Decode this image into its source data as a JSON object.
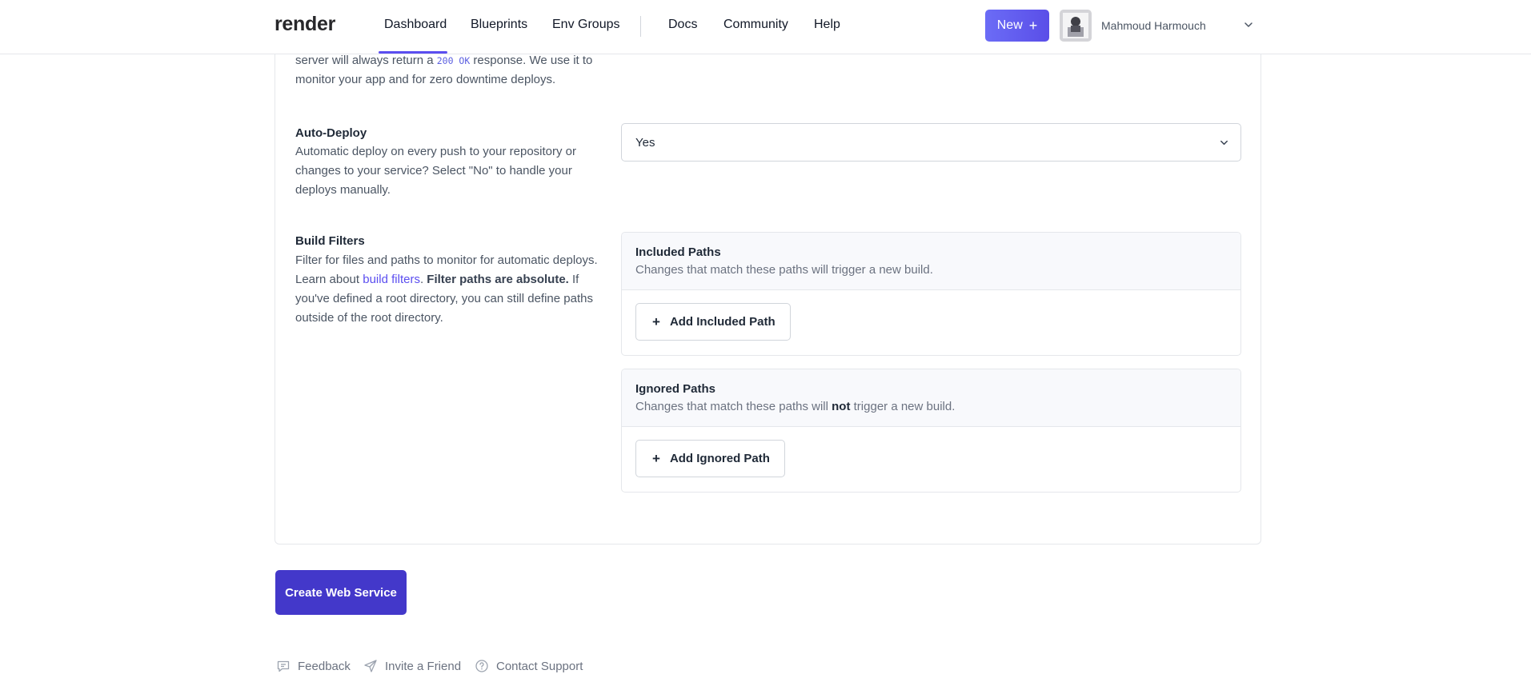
{
  "nav": {
    "logo": "render",
    "links": [
      "Dashboard",
      "Blueprints",
      "Env Groups",
      "Docs",
      "Community",
      "Help"
    ],
    "new_button": "New",
    "user_name": "Mahmoud Harmouch"
  },
  "health": {
    "desc_before": "server will always return a ",
    "code": "200 OK",
    "desc_after": " response. We use it to monitor your app and for zero downtime deploys."
  },
  "auto_deploy": {
    "label": "Auto-Deploy",
    "description": "Automatic deploy on every push to your repository or changes to your service? Select \"No\" to handle your deploys manually.",
    "selected": "Yes"
  },
  "build_filters": {
    "label": "Build Filters",
    "desc_1": "Filter for files and paths to monitor for automatic deploys. Learn about ",
    "link": "build filters",
    "desc_2": ". ",
    "strong": "Filter paths are absolute.",
    "desc_3": " If you've defined a root directory, you can still define paths outside of the root directory.",
    "included": {
      "title": "Included Paths",
      "subtitle": "Changes that match these paths will trigger a new build.",
      "button": "Add Included Path"
    },
    "ignored": {
      "title": "Ignored Paths",
      "sub_before": "Changes that match these paths will ",
      "sub_bold": "not",
      "sub_after": " trigger a new build.",
      "button": "Add Ignored Path"
    }
  },
  "create_button": "Create Web Service",
  "footer": {
    "feedback": "Feedback",
    "invite": "Invite a Friend",
    "support": "Contact Support"
  },
  "colors": {
    "accent": "#5b4ef0",
    "primary_button": "#4338ca"
  }
}
